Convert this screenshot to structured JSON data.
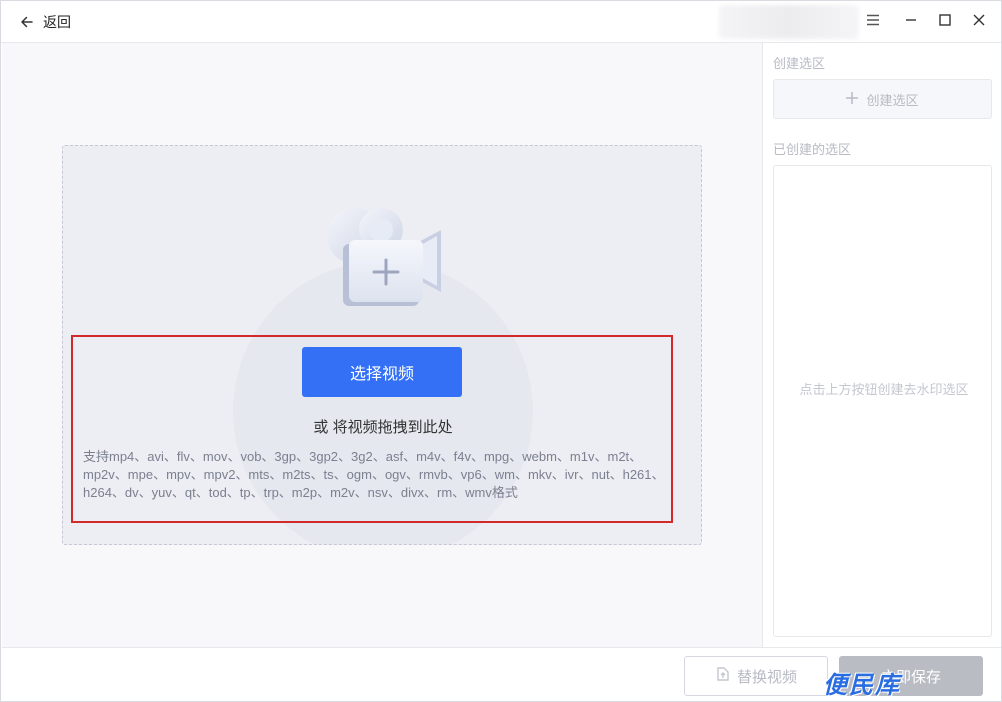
{
  "titlebar": {
    "back_label": "返回"
  },
  "dropzone": {
    "select_button": "选择视频",
    "drag_hint": "或 将视频拖拽到此处",
    "formats_text": "支持mp4、avi、flv、mov、vob、3gp、3gp2、3g2、asf、m4v、f4v、mpg、webm、m1v、m2t、mp2v、mpe、mpv、mpv2、mts、m2ts、ts、ogm、ogv、rmvb、vp6、wm、mkv、ivr、nut、h261、h264、dv、yuv、qt、tod、tp、trp、m2p、m2v、nsv、divx、rm、wmv格式"
  },
  "side": {
    "section_create": "创建选区",
    "create_button": "创建选区",
    "section_created": "已创建的选区",
    "empty_hint": "点击上方按钮创建去水印选区"
  },
  "footer": {
    "replace_button": "替换视频",
    "save_button": "立即保存"
  },
  "overlay": {
    "watermark": "便民库"
  },
  "colors": {
    "accent": "#3370f5",
    "highlight": "#d22a2a",
    "disabled": "#b9bcc3"
  }
}
